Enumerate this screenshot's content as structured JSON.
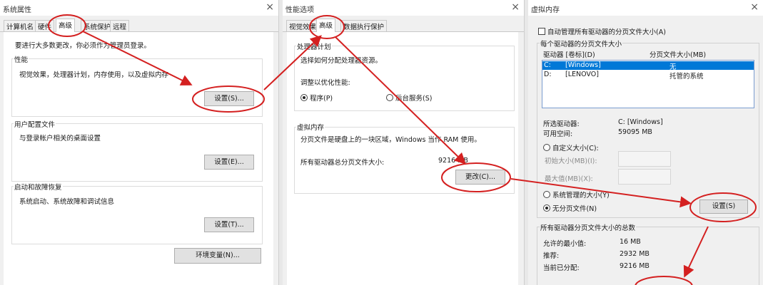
{
  "dialog1": {
    "title": "系统属性",
    "close": "×",
    "tabs": [
      "计算机名",
      "硬件",
      "高级",
      "系统保护",
      "远程"
    ],
    "admin_note": "要进行大多数更改，你必须作为管理员登录。",
    "performance": {
      "title": "性能",
      "desc": "视觉效果，处理器计划，内存使用，以及虚拟内存",
      "button": "设置(S)..."
    },
    "profiles": {
      "title": "用户配置文件",
      "desc": "与登录帐户相关的桌面设置",
      "button": "设置(E)..."
    },
    "startup": {
      "title": "启动和故障恢复",
      "desc": "系统启动、系统故障和调试信息",
      "button": "设置(T)..."
    },
    "env_button": "环境变量(N)..."
  },
  "dialog2": {
    "title": "性能选项",
    "close": "×",
    "tabs": [
      "视觉效果",
      "高级",
      "数据执行保护"
    ],
    "processor": {
      "title": "处理器计划",
      "desc": "选择如何分配处理器资源。",
      "adjust": "调整以优化性能:",
      "opt_programs": "程序(P)",
      "opt_services": "后台服务(S)"
    },
    "vm": {
      "title": "虚拟内存",
      "desc": "分页文件是硬盘上的一块区域，Windows 当作 RAM 使用。",
      "total_label": "所有驱动器总分页文件大小:",
      "total_value": "9216 MB",
      "button": "更改(C)..."
    }
  },
  "dialog3": {
    "title": "虚拟内存",
    "close": "×",
    "auto_manage": "自动管理所有驱动器的分页文件大小(A)",
    "per_drive_title": "每个驱动器的分页文件大小",
    "col_drive": "驱动器 [卷标](D)",
    "col_size": "分页文件大小(MB)",
    "drives": [
      {
        "letter": "C:",
        "label": "[Windows]",
        "size": "无"
      },
      {
        "letter": "D:",
        "label": "[LENOVO]",
        "size": "托管的系统"
      }
    ],
    "selected_drive_label": "所选驱动器:",
    "selected_drive_value": "C:  [Windows]",
    "free_space_label": "可用空间:",
    "free_space_value": "59095 MB",
    "opt_custom": "自定义大小(C):",
    "initial_size": "初始大小(MB)(I):",
    "max_size": "最大值(MB)(X):",
    "opt_system": "系统管理的大小(Y)",
    "opt_none": "无分页文件(N)",
    "set_button": "设置(S)",
    "totals_title": "所有驱动器分页文件大小的总数",
    "min_label": "允许的最小值:",
    "min_value": "16 MB",
    "recommended_label": "推荐:",
    "recommended_value": "2932 MB",
    "current_label": "当前已分配:",
    "current_value": "9216 MB"
  },
  "colors": {
    "annotation": "#d42020",
    "selection": "#0078d7"
  }
}
